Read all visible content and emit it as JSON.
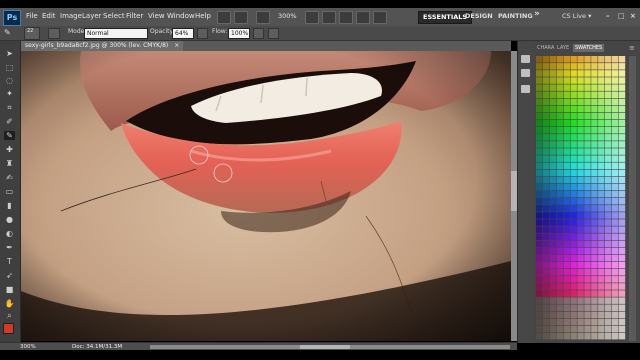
{
  "app": {
    "logo": "Ps"
  },
  "menu": [
    "File",
    "Edit",
    "Image",
    "Layer",
    "Select",
    "Filter",
    "View",
    "Window",
    "Help"
  ],
  "header": {
    "zoom": "300%",
    "workspaces": [
      {
        "label": "ESSENTIALS",
        "active": true
      },
      {
        "label": "DESIGN",
        "active": false
      },
      {
        "label": "PAINTING",
        "active": false
      }
    ],
    "more": "»",
    "cs_live": "CS Live ▾"
  },
  "options": {
    "brush_size": "22",
    "mode_label": "Mode:",
    "mode_value": "Normal",
    "opacity_label": "Opacity:",
    "opacity_value": "64%",
    "flow_label": "Flow:",
    "flow_value": "100%"
  },
  "document": {
    "tab_title": "sexy-girls_b9ada8cf2.jpg @ 300% (lev. CMYK/8)",
    "close": "×"
  },
  "status": {
    "zoom": "300%",
    "doc": "Doc: 34.1M/31.3M"
  },
  "panel": {
    "tabs": [
      {
        "label": "CHARA",
        "active": false
      },
      {
        "label": "LAYE",
        "active": false
      },
      {
        "label": "SWATCHES",
        "active": true
      }
    ]
  },
  "colors": {
    "foreground": "#d23a26",
    "background": "#ffffff",
    "accent": "#2a2a2a"
  },
  "icons": [
    "brush-tool-icon",
    "move-tool-icon",
    "marquee-tool-icon",
    "lasso-tool-icon",
    "magic-wand-icon",
    "crop-tool-icon",
    "eyedropper-icon",
    "healing-brush-icon",
    "clone-stamp-icon",
    "history-brush-icon",
    "eraser-icon",
    "gradient-icon",
    "blur-icon",
    "dodge-icon",
    "pen-icon",
    "type-icon",
    "path-select-icon",
    "shape-icon",
    "hand-icon",
    "zoom-icon"
  ]
}
